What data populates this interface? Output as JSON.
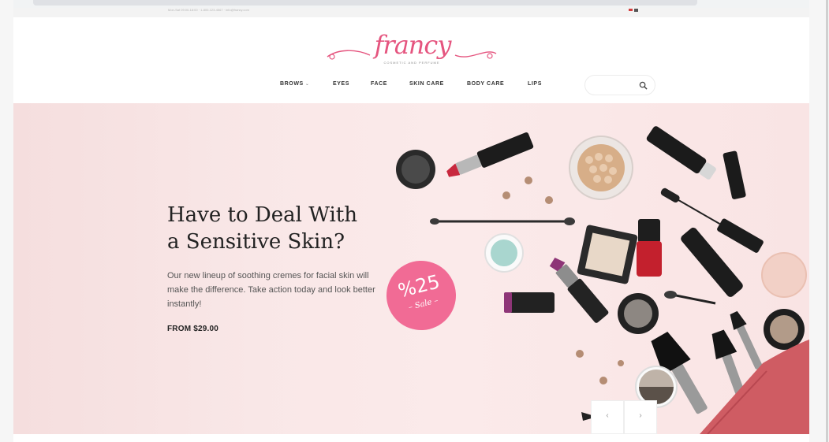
{
  "topbar": {
    "info_text": "Mon-Sat 09:00-18:00 · 1-800-123-4567 · info@francy.com"
  },
  "logo": {
    "word": "francy",
    "tagline": "COSMETIC AND PERFUME"
  },
  "nav": {
    "items": [
      {
        "label": "BROWS",
        "has_dropdown": true
      },
      {
        "label": "EYES"
      },
      {
        "label": "FACE"
      },
      {
        "label": "SKIN CARE"
      },
      {
        "label": "BODY CARE"
      },
      {
        "label": "LIPS"
      }
    ],
    "dropdown_glyph": "⌄"
  },
  "search": {
    "value": "",
    "icon": "search-icon"
  },
  "hero": {
    "title_line1": "Have to Deal With",
    "title_line2": "a Sensitive Skin?",
    "description": "Our new lineup of soothing cremes for facial skin will make the difference. Take action today and look better instantly!",
    "price": "FROM $29.00",
    "sale_percent": "%25",
    "sale_word": "– Sale –",
    "prev_glyph": "‹",
    "next_glyph": "›"
  },
  "colors": {
    "brand": "#e5557f",
    "sale_badge": "#f16b95",
    "hero_bg": "#f9e6e6"
  }
}
